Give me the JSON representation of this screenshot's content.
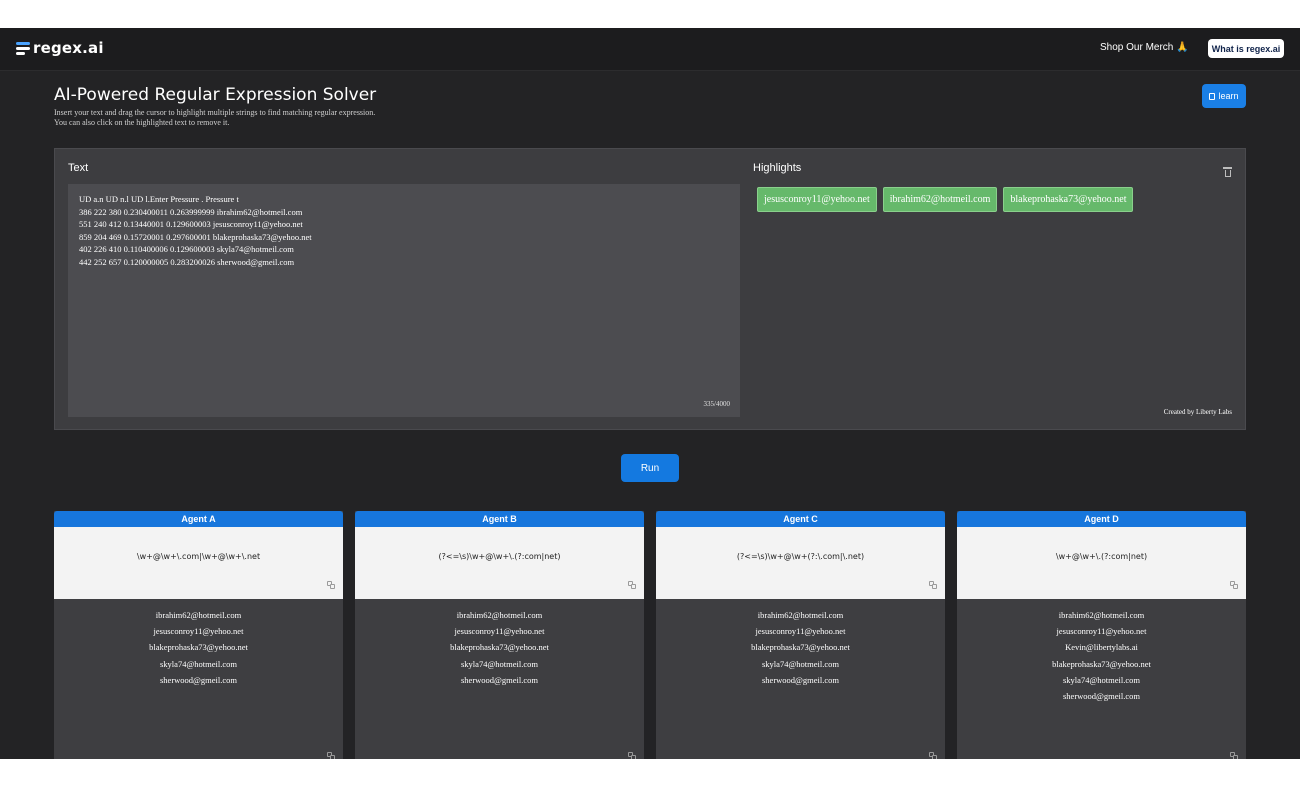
{
  "nav": {
    "logo_text": "regex.ai",
    "shop_label": "Shop Our Merch",
    "shop_emoji": "🙏",
    "what_label": "What is regex.ai"
  },
  "header": {
    "title": "AI-Powered Regular Expression Solver",
    "subtitle_line1": "Insert your text and drag the cursor to highlight multiple strings to find matching regular expression.",
    "subtitle_line2": "You can also click on the highlighted text to remove it.",
    "learn_label": "learn"
  },
  "editor": {
    "label": "Text",
    "lines": [
      "UD a.n UD n.l UD l.Enter Pressure . Pressure t",
      "386 222 380 0.230400011 0.263999999 ibrahim62@hotmeil.com",
      "551 240 412 0.13440001 0.129600003 jesusconroy11@yehoo.net",
      "859 204 469 0.15720001 0.297600001 blakeprohaska73@yehoo.net",
      "402 226 410 0.110400006 0.129600003 skyla74@hotmeil.com",
      "442 252 657 0.120000005 0.283200026 sherwood@gmeil.com"
    ],
    "char_count": "335/4000"
  },
  "highlights": {
    "label": "Highlights",
    "chips": [
      "jesusconroy11@yehoo.net",
      "ibrahim62@hotmeil.com",
      "blakeprohaska73@yehoo.net"
    ],
    "credit": "Created by Liberty Labs"
  },
  "run_label": "Run",
  "agents": [
    {
      "name": "Agent A",
      "regex": "\\w+@\\w+\\.com|\\w+@\\w+\\.net",
      "matches": [
        "ibrahim62@hotmeil.com",
        "jesusconroy11@yehoo.net",
        "blakeprohaska73@yehoo.net",
        "skyla74@hotmeil.com",
        "sherwood@gmeil.com"
      ]
    },
    {
      "name": "Agent B",
      "regex": "(?<=\\s)\\w+@\\w+\\.(?:com|net)",
      "matches": [
        "ibrahim62@hotmeil.com",
        "jesusconroy11@yehoo.net",
        "blakeprohaska73@yehoo.net",
        "skyla74@hotmeil.com",
        "sherwood@gmeil.com"
      ]
    },
    {
      "name": "Agent C",
      "regex": "(?<=\\s)\\w+@\\w+(?:\\.com|\\.net)",
      "matches": [
        "ibrahim62@hotmeil.com",
        "jesusconroy11@yehoo.net",
        "blakeprohaska73@yehoo.net",
        "skyla74@hotmeil.com",
        "sherwood@gmeil.com"
      ]
    },
    {
      "name": "Agent D",
      "regex": "\\w+@\\w+\\.(?:com|net)",
      "matches": [
        "ibrahim62@hotmeil.com",
        "jesusconroy11@yehoo.net",
        "Kevin@libertylabs.ai",
        "blakeprohaska73@yehoo.net",
        "skyla74@hotmeil.com",
        "sherwood@gmeil.com"
      ]
    }
  ]
}
